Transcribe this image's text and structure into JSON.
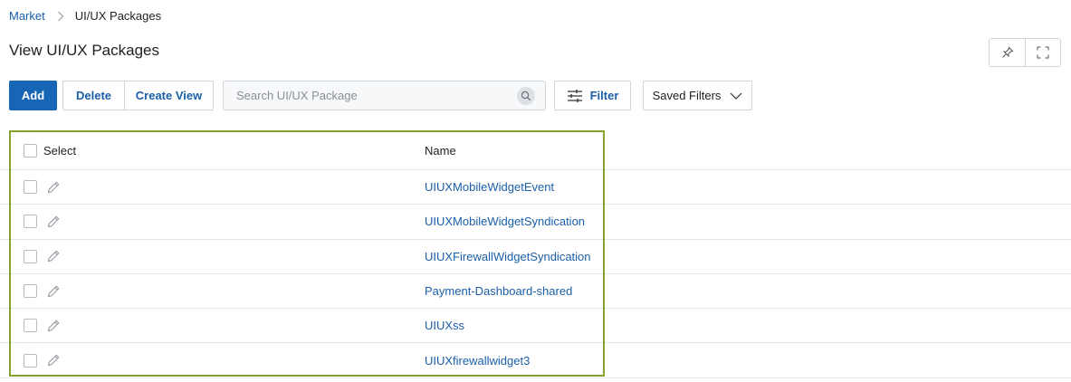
{
  "breadcrumb": {
    "items": [
      {
        "label": "Market",
        "is_link": true
      },
      {
        "label": "UI/UX Packages",
        "is_link": false
      }
    ],
    "separator_icon": "chevron-right-icon"
  },
  "page": {
    "title": "View UI/UX Packages"
  },
  "top_right_actions": [
    {
      "icon": "pin-icon"
    },
    {
      "icon": "fullscreen-icon"
    }
  ],
  "toolbar": {
    "add_label": "Add",
    "delete_label": "Delete",
    "create_view_label": "Create View",
    "filter_label": "Filter",
    "saved_filters_label": "Saved Filters"
  },
  "search": {
    "placeholder": "Search UI/UX Package",
    "value": ""
  },
  "table": {
    "columns": [
      "Select",
      "Name"
    ],
    "rows": [
      {
        "name": "UIUXMobileWidgetEvent"
      },
      {
        "name": "UIUXMobileWidgetSyndication"
      },
      {
        "name": "UIUXFirewallWidgetSyndication"
      },
      {
        "name": "Payment-Dashboard-shared"
      },
      {
        "name": "UIUXss"
      },
      {
        "name": "UIUXfirewallwidget3"
      }
    ]
  },
  "colors": {
    "accent_blue": "#1765b5",
    "link_blue": "#1a5fa8",
    "highlight_green": "#86a22a",
    "border_gray": "#cfd4da"
  }
}
